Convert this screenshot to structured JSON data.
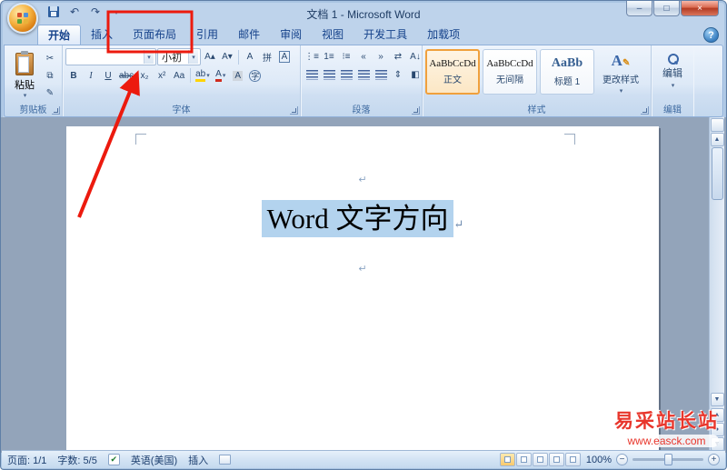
{
  "window": {
    "title": "文档 1 - Microsoft Word"
  },
  "tabs": [
    {
      "label": "开始"
    },
    {
      "label": "插入"
    },
    {
      "label": "页面布局"
    },
    {
      "label": "引用"
    },
    {
      "label": "邮件"
    },
    {
      "label": "审阅"
    },
    {
      "label": "视图"
    },
    {
      "label": "开发工具"
    },
    {
      "label": "加载项"
    }
  ],
  "ribbon": {
    "clipboard": {
      "group_label": "剪贴板",
      "paste_label": "粘贴"
    },
    "font": {
      "group_label": "字体",
      "font_name": "",
      "font_size": "小初"
    },
    "paragraph": {
      "group_label": "段落"
    },
    "styles": {
      "group_label": "样式",
      "gallery": [
        {
          "preview": "AaBbCcDd",
          "name": "正文"
        },
        {
          "preview": "AaBbCcDd",
          "name": "无间隔"
        },
        {
          "preview": "AaBb",
          "name": "标题 1"
        }
      ],
      "change_label": "更改样式"
    },
    "editing": {
      "group_label": "编辑",
      "button_label": "编辑"
    }
  },
  "icons": {
    "dropdown": "▾",
    "minimize": "–",
    "maximize": "□",
    "close": "×",
    "undo": "↶",
    "redo": "↷",
    "help": "?",
    "cut": "✂",
    "copy": "⧉",
    "format_painter": "✎",
    "grow_font": "A▴",
    "shrink_font": "A▾",
    "clear_format": "A",
    "pinyin": "拼",
    "char_border": "A",
    "bold": "B",
    "italic": "I",
    "underline": "U",
    "strikethrough": "abc",
    "subscript": "x₂",
    "superscript": "x²",
    "change_case": "Aa",
    "highlight": "ab",
    "font_color": "A",
    "char_shading": "A",
    "enclose": "字",
    "bullets": "⋮≡",
    "numbering": "1≡",
    "multilevel": "⁝≡",
    "indent_decrease": "«",
    "indent_increase": "»",
    "asian_layout": "⇄",
    "sort": "A↓",
    "show_marks": "↵",
    "line_spacing": "⇕",
    "shading": "◧",
    "borders": "⊞",
    "scroll_up": "▲",
    "scroll_down": "▼",
    "prev_page": "▲",
    "browse_object": "●",
    "next_page": "▼",
    "spell_check": "✔",
    "zoom_out": "−",
    "zoom_in": "+"
  },
  "document": {
    "selected_text": "Word 文字方向",
    "paragraph_mark": "↵"
  },
  "statusbar": {
    "page": "页面: 1/1",
    "words": "字数: 5/5",
    "language": "英语(美国)",
    "insert_mode": "插入",
    "zoom": "100%"
  },
  "watermark": {
    "title": "易采站长站",
    "url": "www.easck.com"
  },
  "colors": {
    "annotation": "#ec1a0e",
    "selection": "#b3d3ee",
    "style_selected_border": "#f0a03c",
    "watermark": "#e8362c"
  }
}
